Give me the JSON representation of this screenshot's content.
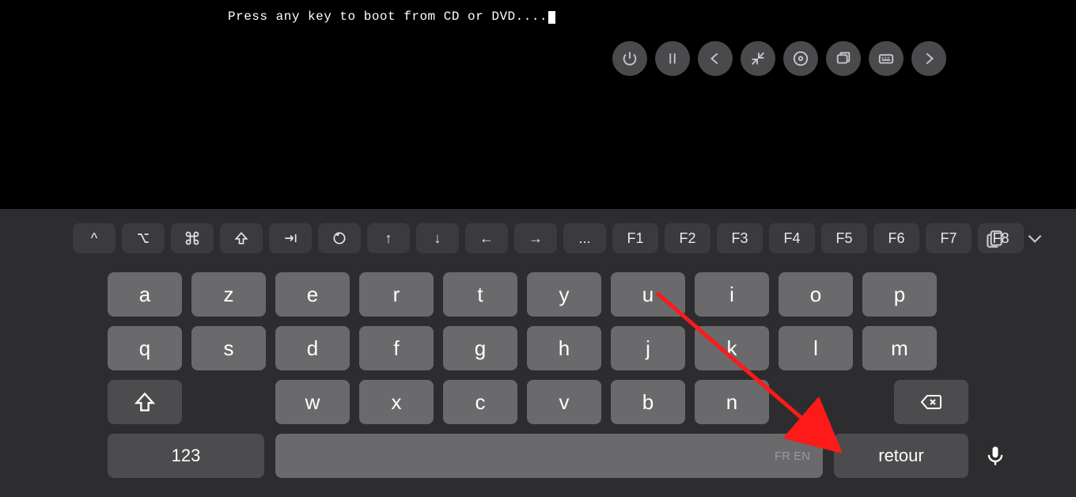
{
  "console": {
    "text": "Press any key to boot from CD or DVD...."
  },
  "toolbar": {
    "power": "power-icon",
    "pause": "pause-icon",
    "back": "back-icon",
    "shrink": "shrink-icon",
    "disc": "disc-icon",
    "windows": "windows-icon",
    "keyboard": "keyboard-icon",
    "forward": "forward-icon"
  },
  "fnrow": {
    "caret": "^",
    "option": "⌥",
    "command": "⌘",
    "shift": "⇧",
    "tab": "⇥",
    "escape": "esc-icon",
    "up": "↑",
    "down": "↓",
    "left": "←",
    "right": "→",
    "ellipsis": "...",
    "f": [
      "F1",
      "F2",
      "F3",
      "F4",
      "F5",
      "F6",
      "F7",
      "F8"
    ]
  },
  "rows": {
    "r1": [
      "a",
      "z",
      "e",
      "r",
      "t",
      "y",
      "u",
      "i",
      "o",
      "p"
    ],
    "r2": [
      "q",
      "s",
      "d",
      "f",
      "g",
      "h",
      "j",
      "k",
      "l",
      "m"
    ],
    "r3": [
      "w",
      "x",
      "c",
      "v",
      "b",
      "n"
    ]
  },
  "bottom": {
    "numbers": "123",
    "space_hint": "FR EN",
    "return": "retour"
  }
}
